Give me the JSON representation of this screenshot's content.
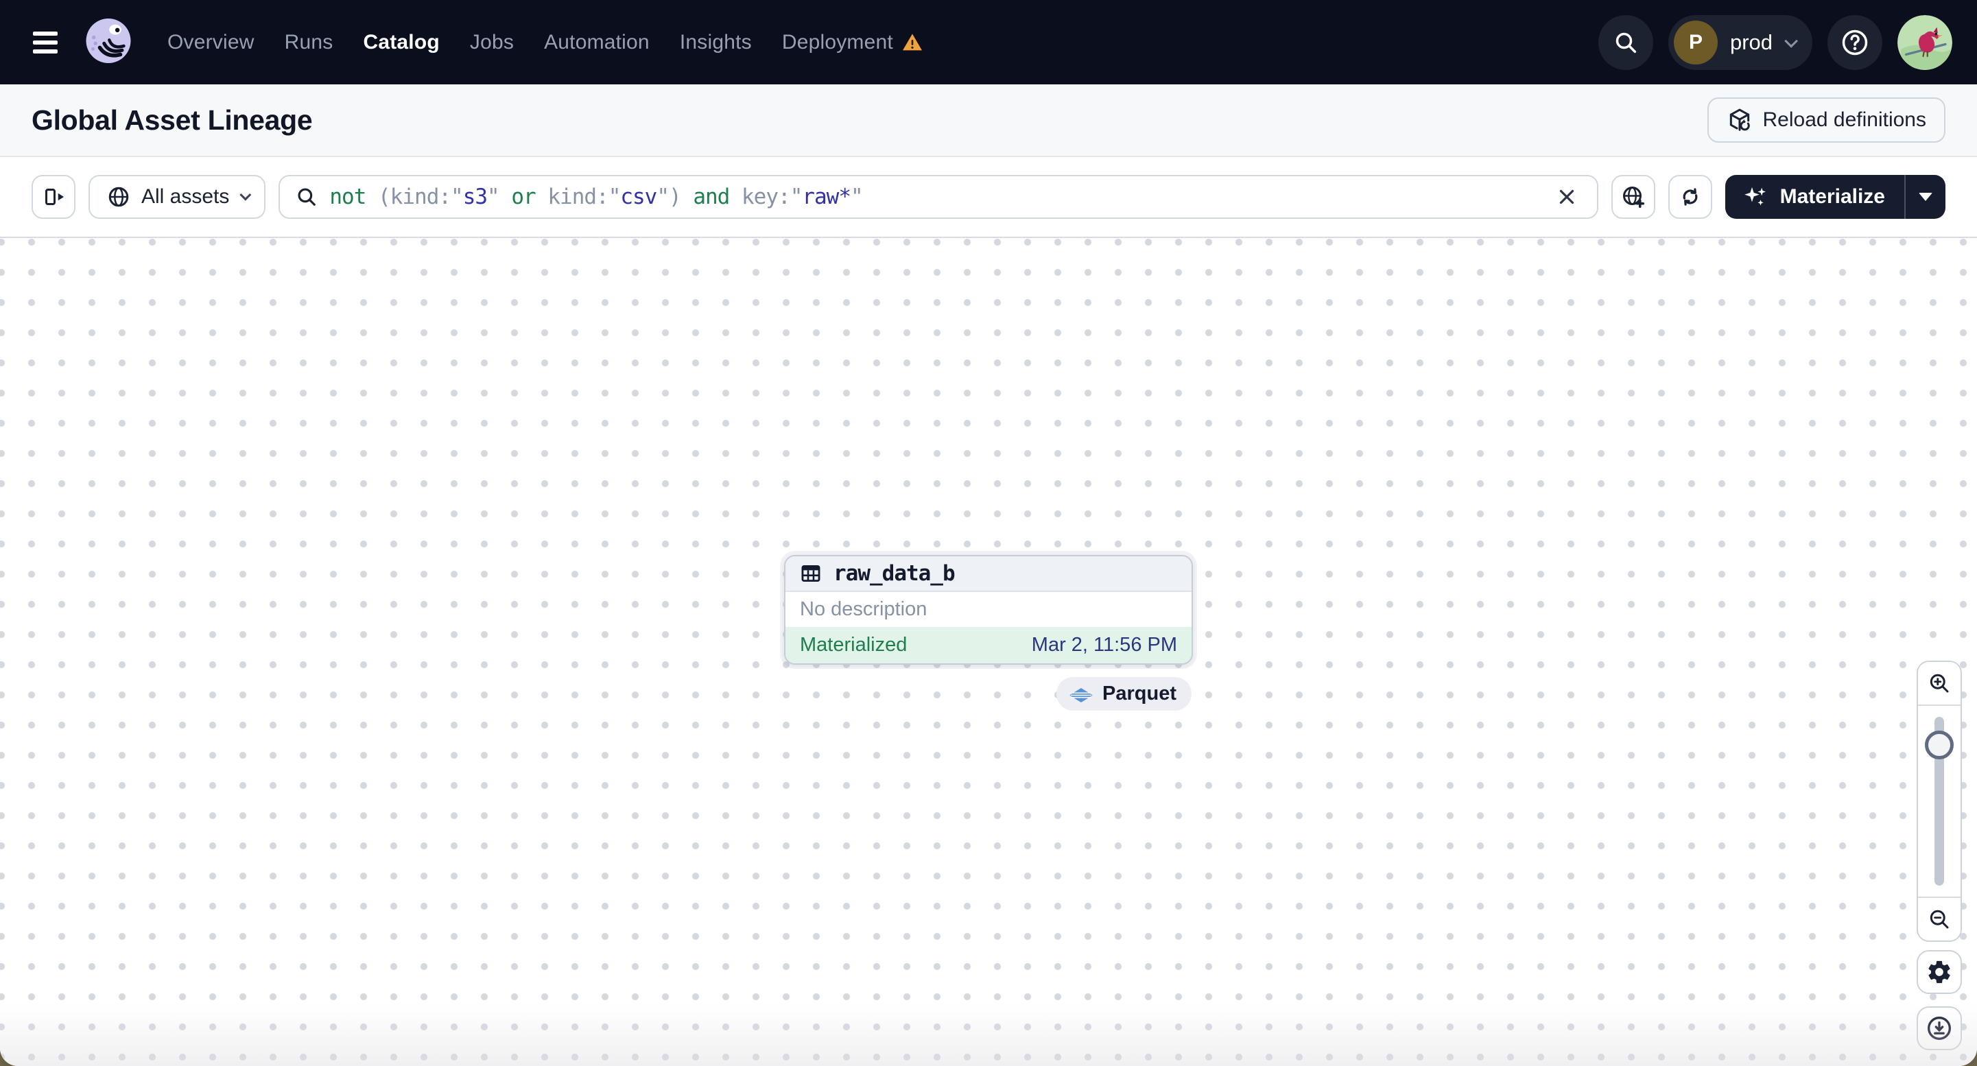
{
  "nav": {
    "items": [
      {
        "label": "Overview",
        "active": false,
        "warning": false
      },
      {
        "label": "Runs",
        "active": false,
        "warning": false
      },
      {
        "label": "Catalog",
        "active": true,
        "warning": false
      },
      {
        "label": "Jobs",
        "active": false,
        "warning": false
      },
      {
        "label": "Automation",
        "active": false,
        "warning": false
      },
      {
        "label": "Insights",
        "active": false,
        "warning": false
      },
      {
        "label": "Deployment",
        "active": false,
        "warning": true
      }
    ],
    "environment": {
      "initial": "P",
      "name": "prod"
    }
  },
  "header": {
    "title": "Global Asset Lineage",
    "reload_label": "Reload definitions"
  },
  "toolbar": {
    "scope_label": "All assets",
    "materialize_label": "Materialize",
    "query_tokens": [
      {
        "text": "not ",
        "type": "keyword"
      },
      {
        "text": "(kind:",
        "type": "field"
      },
      {
        "text": "\"",
        "type": "quote"
      },
      {
        "text": "s3",
        "type": "value"
      },
      {
        "text": "\"",
        "type": "quote"
      },
      {
        "text": " ",
        "type": "field"
      },
      {
        "text": "or",
        "type": "keyword"
      },
      {
        "text": " kind:",
        "type": "field"
      },
      {
        "text": "\"",
        "type": "quote"
      },
      {
        "text": "csv",
        "type": "value"
      },
      {
        "text": "\"",
        "type": "quote"
      },
      {
        "text": ") ",
        "type": "field"
      },
      {
        "text": "and",
        "type": "keyword"
      },
      {
        "text": " key:",
        "type": "field"
      },
      {
        "text": "\"",
        "type": "quote"
      },
      {
        "text": "raw*",
        "type": "value"
      },
      {
        "text": "\"",
        "type": "quote"
      }
    ]
  },
  "graph": {
    "node": {
      "name": "raw_data_b",
      "description": "No description",
      "status": "Materialized",
      "timestamp": "Mar 2, 11:56 PM",
      "kind": "Parquet"
    }
  },
  "colors": {
    "nav_bg": "#0b0e1c",
    "accent_dark": "#161d2f",
    "status_green": "#1e7e4e",
    "status_green_bg": "#e2f3e9",
    "timestamp_navy": "#2a3780",
    "query_keyword": "#1e7e4e",
    "query_field": "#8791a5",
    "query_value": "#3231a9",
    "warning_orange": "#f0a23c",
    "parquet_blue": "#5793d4"
  }
}
